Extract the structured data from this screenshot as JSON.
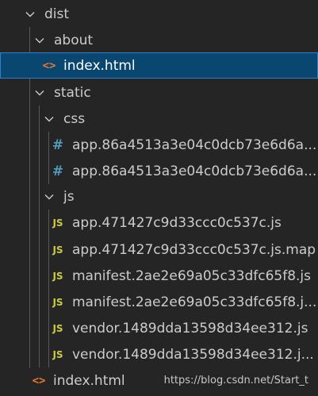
{
  "tree": {
    "dist": {
      "label": "dist",
      "icon": "chevron-down-icon"
    },
    "about": {
      "label": "about",
      "icon": "chevron-down-icon"
    },
    "about_index": {
      "label": "index.html",
      "icon": "html-file-icon",
      "icon_glyph": "<>"
    },
    "static": {
      "label": "static",
      "icon": "chevron-down-icon"
    },
    "css": {
      "label": "css",
      "icon": "chevron-down-icon"
    },
    "css_files": [
      {
        "label": "app.86a4513a3e04c0dcb73e6d6a...",
        "icon": "css-file-icon",
        "icon_glyph": "#"
      },
      {
        "label": "app.86a4513a3e04c0dcb73e6d6a...",
        "icon": "css-file-icon",
        "icon_glyph": "#"
      }
    ],
    "js": {
      "label": "js",
      "icon": "chevron-down-icon"
    },
    "js_files": [
      {
        "label": "app.471427c9d33ccc0c537c.js",
        "icon": "js-file-icon",
        "icon_glyph": "JS"
      },
      {
        "label": "app.471427c9d33ccc0c537c.js.map",
        "icon": "js-file-icon",
        "icon_glyph": "JS"
      },
      {
        "label": "manifest.2ae2e69a05c33dfc65f8.js",
        "icon": "js-file-icon",
        "icon_glyph": "JS"
      },
      {
        "label": "manifest.2ae2e69a05c33dfc65f8.j...",
        "icon": "js-file-icon",
        "icon_glyph": "JS"
      },
      {
        "label": "vendor.1489dda13598d34ee312.js",
        "icon": "js-file-icon",
        "icon_glyph": "JS"
      },
      {
        "label": "vendor.1489dda13598d34ee312.j...",
        "icon": "js-file-icon",
        "icon_glyph": "JS"
      }
    ],
    "root_index": {
      "label": "index.html",
      "icon": "html-file-icon",
      "icon_glyph": "<>"
    }
  },
  "watermark": "https://blog.csdn.net/Start_t",
  "colors": {
    "background": "#252526",
    "selected_bg": "#094771",
    "selected_border": "#2f7fcf",
    "text": "#cccccc",
    "html_icon": "#e37933",
    "css_icon": "#519aba",
    "js_icon": "#cbcb41"
  }
}
